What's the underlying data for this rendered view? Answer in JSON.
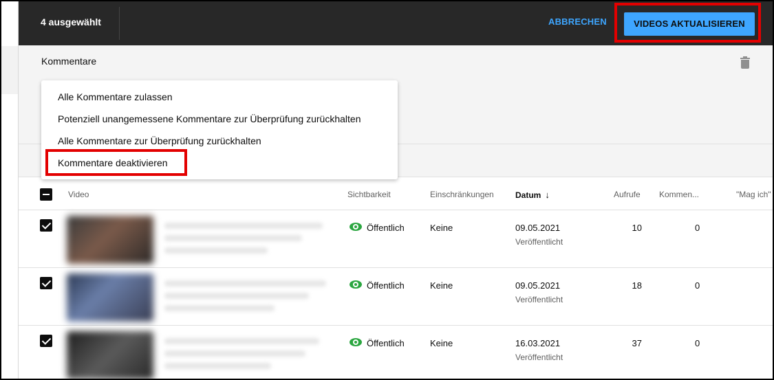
{
  "header": {
    "selected_count": "4 ausgewählt",
    "cancel_label": "ABBRECHEN",
    "update_label": "VIDEOS AKTUALISIEREN"
  },
  "panel": {
    "title": "Kommentare",
    "options": [
      "Alle Kommentare zulassen",
      "Potenziell unangemessene Kommentare zur Überprüfung zurückhalten",
      "Alle Kommentare zur Überprüfung zurückhalten",
      "Kommentare deaktivieren"
    ]
  },
  "table": {
    "columns": {
      "video": "Video",
      "visibility": "Sichtbarkeit",
      "restrictions": "Einschränkungen",
      "date": "Datum",
      "views": "Aufrufe",
      "comments": "Kommen...",
      "likes": "\"Mag ich\" ("
    },
    "rows": [
      {
        "visibility": "Öffentlich",
        "restrictions": "Keine",
        "date": "09.05.2021",
        "status": "Veröffentlicht",
        "views": "10",
        "comments": "0"
      },
      {
        "visibility": "Öffentlich",
        "restrictions": "Keine",
        "date": "09.05.2021",
        "status": "Veröffentlicht",
        "views": "18",
        "comments": "0"
      },
      {
        "visibility": "Öffentlich",
        "restrictions": "Keine",
        "date": "16.03.2021",
        "status": "Veröffentlicht",
        "views": "37",
        "comments": "0"
      }
    ]
  },
  "colors": {
    "accent": "#3ea6ff",
    "topbar": "#282828",
    "highlight": "#e30000",
    "public_green": "#2ba640"
  }
}
